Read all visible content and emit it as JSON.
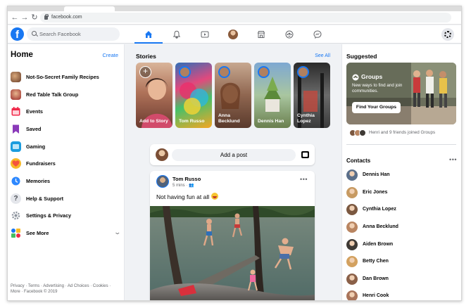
{
  "browser": {
    "url": "facebook.com"
  },
  "header": {
    "logo": "f",
    "search_placeholder": "Search Facebook",
    "nav": [
      {
        "icon": "home-icon",
        "active": true
      },
      {
        "icon": "bell-icon",
        "active": false
      },
      {
        "icon": "watch-icon",
        "active": false
      },
      {
        "icon": "profile-avatar",
        "active": false
      },
      {
        "icon": "marketplace-icon",
        "active": false
      },
      {
        "icon": "groups-icon",
        "active": false
      },
      {
        "icon": "messenger-icon",
        "active": false
      }
    ]
  },
  "sidebar": {
    "title": "Home",
    "create": "Create",
    "items": [
      {
        "label": "Not-So-Secret Family Recipes",
        "icon": "group-photo-icon",
        "color": "#8b5a3c"
      },
      {
        "label": "Red Table Talk Group",
        "icon": "group-photo-icon",
        "color": "#b23a3a"
      },
      {
        "label": "Events",
        "icon": "calendar-icon",
        "color": "#e4405f"
      },
      {
        "label": "Saved",
        "icon": "bookmark-icon",
        "color": "#8a3ab9"
      },
      {
        "label": "Gaming",
        "icon": "gaming-icon",
        "color": "#1b9cde"
      },
      {
        "label": "Fundraisers",
        "icon": "heart-icon",
        "color": "#f5533d"
      },
      {
        "label": "Memories",
        "icon": "clock-icon",
        "color": "#1877f2"
      },
      {
        "label": "Help & Support",
        "icon": "question-icon",
        "color": "#8d949e"
      },
      {
        "label": "Settings & Privacy",
        "icon": "gear-icon",
        "color": "#8d949e"
      },
      {
        "label": "See More",
        "icon": "tiles-icon",
        "color": "#1877f2"
      }
    ],
    "footer": "Privacy · Terms · Advertising · Ad Choices · Cookies · More · Facebook © 2019"
  },
  "stories": {
    "title": "Stories",
    "see_all": "See All",
    "items": [
      {
        "name": "Add to Story"
      },
      {
        "name": "Tom Russo"
      },
      {
        "name": "Anna Becklund"
      },
      {
        "name": "Dennis Han"
      },
      {
        "name": "Cynthia Lopez"
      }
    ]
  },
  "composer": {
    "label": "Add a post"
  },
  "post": {
    "author": "Tom Russo",
    "time": "5 mins",
    "text": "Not having fun at all"
  },
  "suggested": {
    "title": "Suggested",
    "card_title": "Groups",
    "card_desc": "New ways to find and join communities.",
    "card_button": "Find Your Groups",
    "joined_text": "Henri and 9 friends joined Groups"
  },
  "contacts": {
    "title": "Contacts",
    "items": [
      {
        "name": "Dennis Han",
        "color": "#5b6f8a"
      },
      {
        "name": "Eric Jones",
        "color": "#c79a62"
      },
      {
        "name": "Cynthia Lopez",
        "color": "#7b5840"
      },
      {
        "name": "Anna Becklund",
        "color": "#b98561"
      },
      {
        "name": "Aiden Brown",
        "color": "#3f3a35"
      },
      {
        "name": "Betty Chen",
        "color": "#d3a15f"
      },
      {
        "name": "Dan Brown",
        "color": "#8a6048"
      },
      {
        "name": "Henri Cook",
        "color": "#a9745a"
      }
    ]
  }
}
